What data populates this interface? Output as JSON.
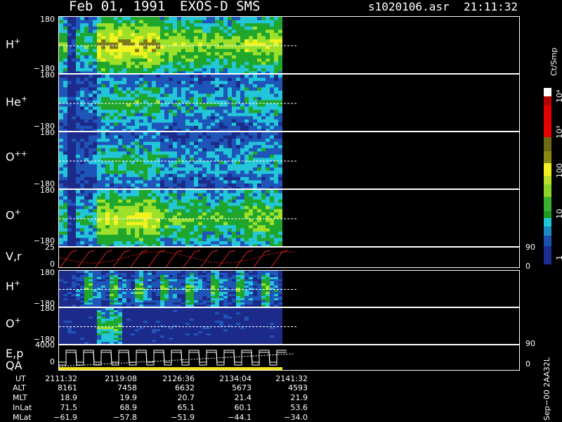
{
  "header": {
    "date": "Feb 01, 1991",
    "instrument": "EXOS-D SMS",
    "file": "s1020106.asr",
    "time": "21:11:32"
  },
  "panels": [
    {
      "id": "h-plus-1",
      "label": "H",
      "sup": "+",
      "top_tick": "180",
      "bottom_tick": "−180"
    },
    {
      "id": "he-plus",
      "label": "He",
      "sup": "+",
      "top_tick": "180",
      "bottom_tick": "−180"
    },
    {
      "id": "o-plusplus",
      "label": "O",
      "sup": "++",
      "top_tick": "180",
      "bottom_tick": "−180"
    },
    {
      "id": "o-plus-1",
      "label": "O",
      "sup": "+",
      "top_tick": "180",
      "bottom_tick": "−180"
    },
    {
      "id": "vr",
      "label": "V,r",
      "sup": "",
      "top_tick": "25",
      "bottom_tick": "0",
      "right_top": "90",
      "right_bottom": "0"
    },
    {
      "id": "h-plus-2",
      "label": "H",
      "sup": "+",
      "top_tick": "180",
      "bottom_tick": "−180"
    },
    {
      "id": "o-plus-2",
      "label": "O",
      "sup": "+",
      "top_tick": "180",
      "bottom_tick": "−180"
    },
    {
      "id": "ep",
      "label": "E,p",
      "sup": "",
      "top_tick": "4000",
      "bottom_tick": "0",
      "right_top": "90",
      "right_bottom": "0"
    }
  ],
  "qa_label": "QA",
  "colorbar": {
    "unit": "Ct/Smp",
    "ticks": [
      "10⁴",
      "10³",
      "100",
      "10",
      "1"
    ]
  },
  "table": {
    "row_labels": [
      "UT",
      "ALT",
      "MLT",
      "InLat",
      "MLat"
    ],
    "columns": [
      [
        "2111:32",
        "8161",
        "18.9",
        "71.5",
        "−61.9"
      ],
      [
        "2119:08",
        "7458",
        "19.9",
        "68.9",
        "−57.8"
      ],
      [
        "2126:36",
        "6632",
        "20.7",
        "65.1",
        "−51.9"
      ],
      [
        "2134:04",
        "5673",
        "21.4",
        "60.1",
        "−44.1"
      ],
      [
        "2141:32",
        "4593",
        "21.9",
        "53.6",
        "−34.0"
      ]
    ]
  },
  "footer_id": "Sep−00 2AA32L",
  "chart_data": {
    "type": "heatmap",
    "title": "Feb 01, 1991 EXOS-D SMS",
    "x_ticks": [
      "2111:32",
      "2119:08",
      "2126:36",
      "2134:04",
      "2141:32"
    ],
    "colorbar_unit": "Ct/Smp",
    "colorbar_ticks": [
      "1",
      "10",
      "100",
      "10³",
      "10⁴"
    ],
    "colors": {
      "navy": "#1c2a8a",
      "blue": "#1f54b8",
      "cyan": "#22c6d8",
      "green": "#1fa62c",
      "lime": "#9de02a",
      "yellow": "#f2f21e",
      "olive": "#7a7a18",
      "red": "#d40000",
      "white": "#ffffff"
    }
  }
}
